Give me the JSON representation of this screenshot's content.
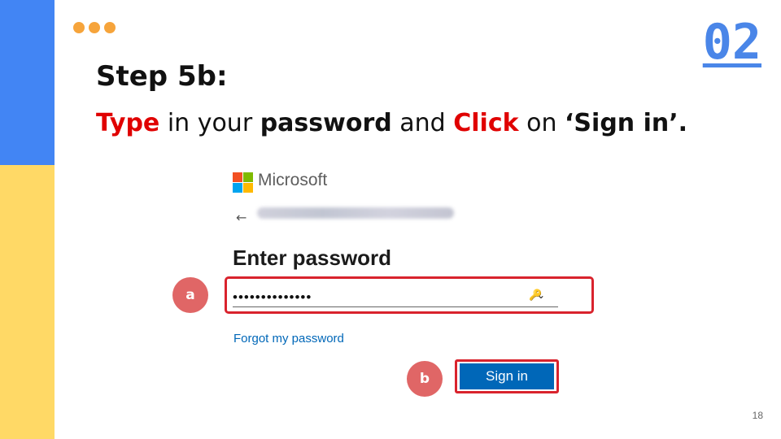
{
  "slide": {
    "step_number": "02",
    "step_title": "Step 5b:",
    "instruction": {
      "word_type": "Type",
      "text_1": " in your ",
      "word_password": "password",
      "text_2": " and ",
      "word_click": "Click",
      "text_3": " on ",
      "word_signin": "‘Sign in’."
    },
    "page_number": "18",
    "colors": {
      "side_blue": "#4285f4",
      "side_yellow": "#ffd966",
      "dots": "#f6a43b",
      "accent_red": "#e00000",
      "marker": "#e06666"
    }
  },
  "ms_signin": {
    "brand": "Microsoft",
    "back_icon": "←",
    "heading": "Enter password",
    "password_value": "••••••••••••••",
    "key_icon": "🔑",
    "chevron_icon": "⌄",
    "forgot_link": "Forgot my password",
    "signin_button": "Sign in",
    "colors": {
      "button_bg": "#0067b8",
      "highlight": "#d9232d",
      "logo_red": "#f25022",
      "logo_green": "#7fba00",
      "logo_blue": "#00a4ef",
      "logo_yellow": "#ffb900"
    }
  },
  "markers": {
    "a": "a",
    "b": "b"
  }
}
